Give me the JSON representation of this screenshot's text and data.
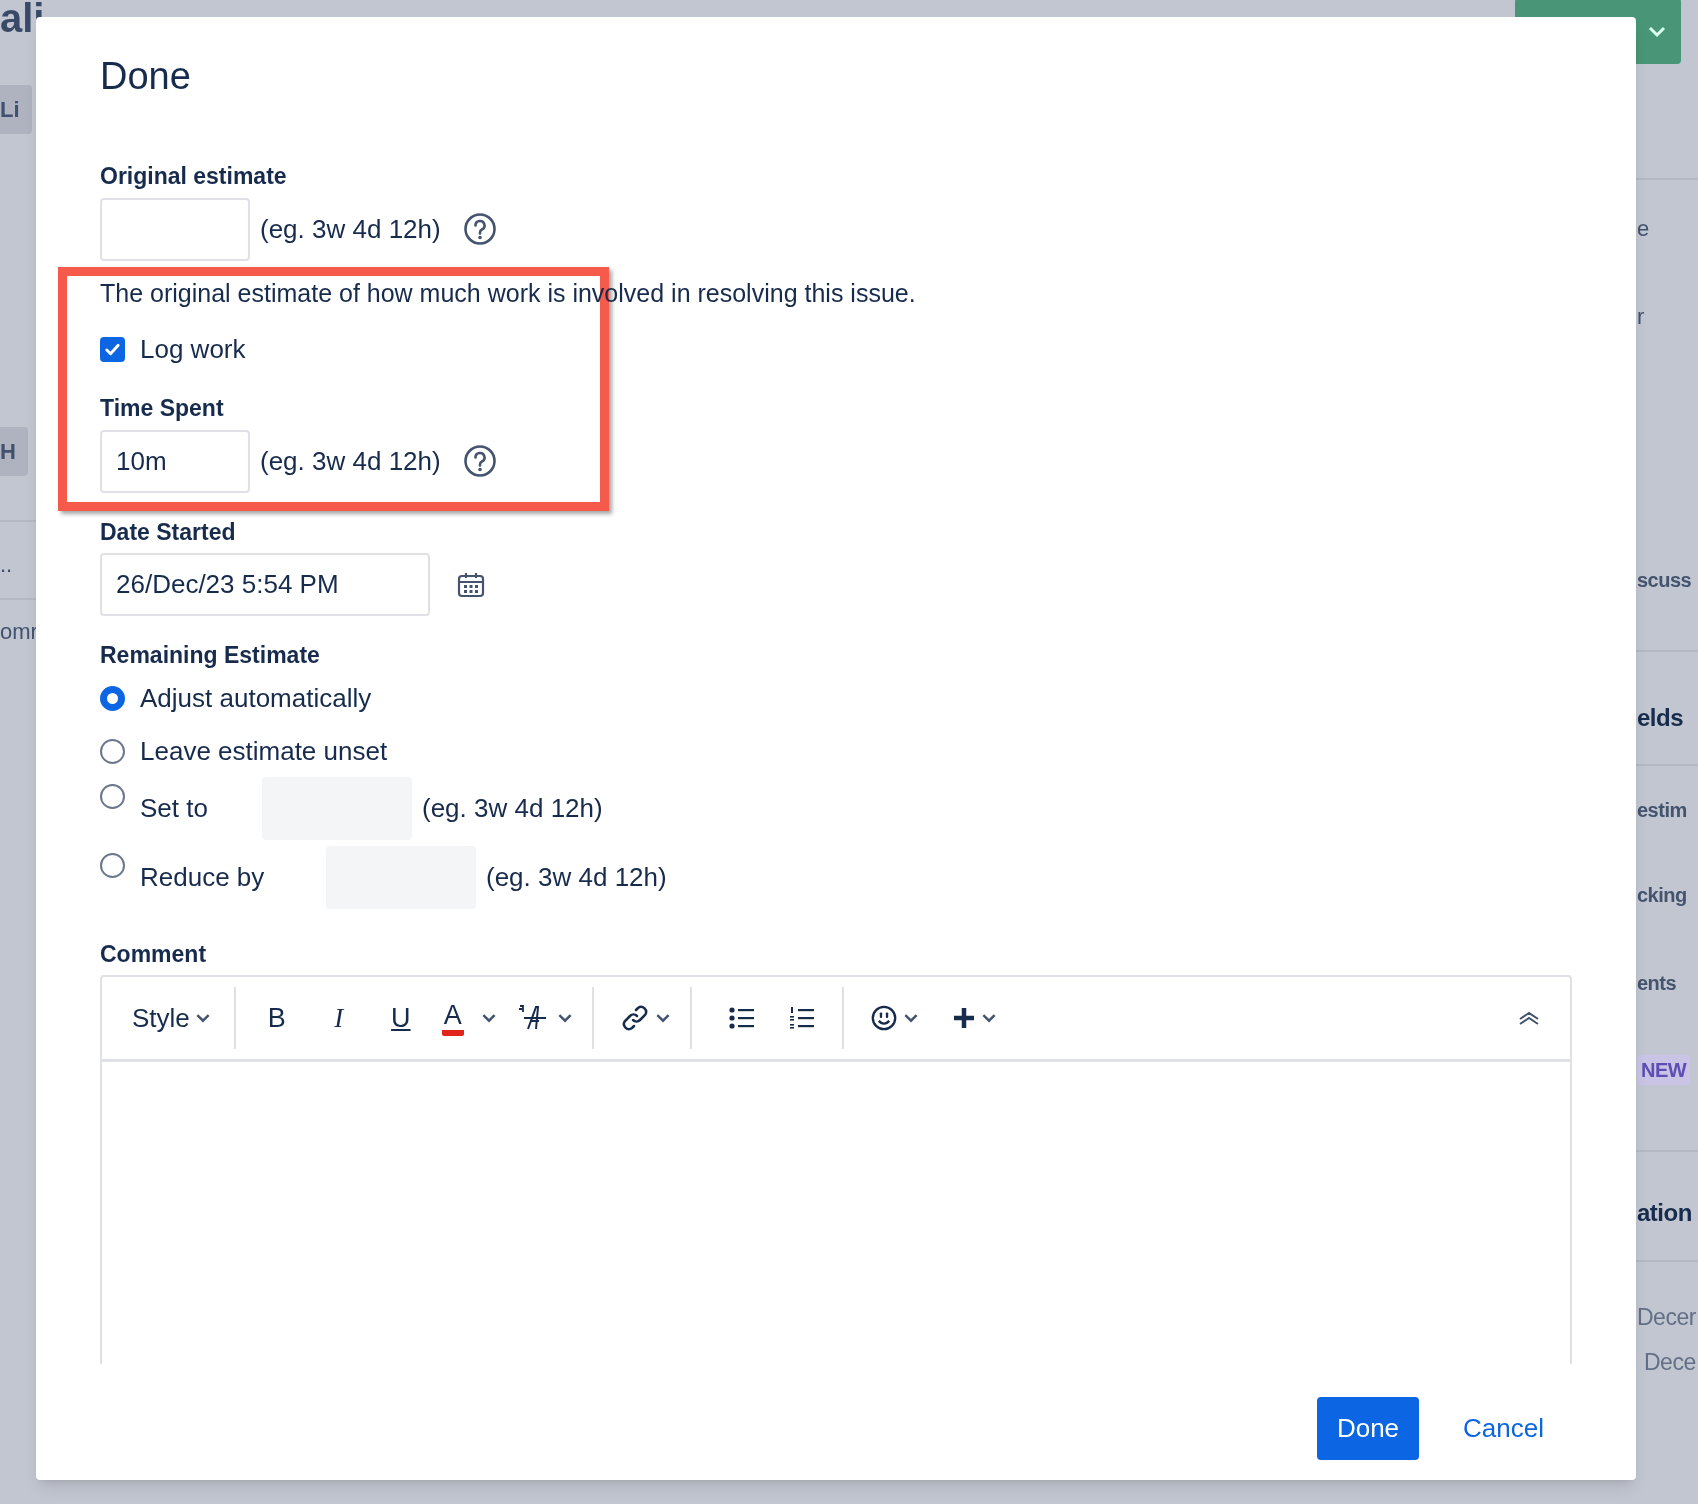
{
  "background": {
    "page_title": "ali",
    "left_items": [
      {
        "text": "Li",
        "kind": "tab"
      },
      {
        "text": "H",
        "kind": "tab"
      },
      {
        "text": "..",
        "kind": "text"
      },
      {
        "text": "omr",
        "kind": "text"
      }
    ],
    "right_items": [
      {
        "text": "e",
        "kind": "text"
      },
      {
        "text": "r",
        "kind": "text"
      },
      {
        "text": "scuss",
        "kind": "heading"
      },
      {
        "text": "elds",
        "kind": "title"
      },
      {
        "text": "estim",
        "kind": "heading"
      },
      {
        "text": "cking",
        "kind": "heading"
      },
      {
        "text": "ents",
        "kind": "heading"
      },
      {
        "text": "NEW",
        "kind": "badge"
      },
      {
        "text": "ation",
        "kind": "title"
      },
      {
        "text": "Decer",
        "kind": "date"
      },
      {
        "text": "Dece",
        "kind": "date"
      }
    ]
  },
  "dialog": {
    "title": "Done",
    "original_estimate": {
      "label": "Original estimate",
      "hint": "(eg. 3w 4d 12h)",
      "description": "The original estimate of how much work is involved in resolving this issue."
    },
    "log_work": {
      "label": "Log work",
      "checked": true
    },
    "time_spent": {
      "label": "Time Spent",
      "value": "10m",
      "hint": "(eg. 3w 4d 12h)"
    },
    "date_started": {
      "label": "Date Started",
      "value": "26/Dec/23 5:54 PM"
    },
    "remaining_estimate": {
      "label": "Remaining Estimate",
      "options": [
        {
          "label": "Adjust automatically",
          "selected": true,
          "kind": "plain"
        },
        {
          "label": "Leave estimate unset",
          "selected": false,
          "kind": "plain"
        },
        {
          "label": "Set to",
          "selected": false,
          "kind": "field",
          "hint": "(eg. 3w 4d 12h)"
        },
        {
          "label": "Reduce by",
          "selected": false,
          "kind": "field",
          "hint": "(eg. 3w 4d 12h)"
        }
      ]
    },
    "comment": {
      "label": "Comment",
      "toolbar": [
        {
          "kind": "style",
          "label": "Style"
        },
        {
          "kind": "divider"
        },
        {
          "kind": "bold",
          "label": "B"
        },
        {
          "kind": "italic",
          "label": "I"
        },
        {
          "kind": "underline",
          "label": "U"
        },
        {
          "kind": "color",
          "label": "A"
        },
        {
          "kind": "more_format"
        },
        {
          "kind": "divider"
        },
        {
          "kind": "link"
        },
        {
          "kind": "divider"
        },
        {
          "kind": "bullets"
        },
        {
          "kind": "numbers"
        },
        {
          "kind": "divider"
        },
        {
          "kind": "emoji"
        },
        {
          "kind": "insert"
        }
      ]
    },
    "buttons": [
      {
        "label": "Done",
        "kind": "primary"
      },
      {
        "label": "Cancel",
        "kind": "link"
      }
    ]
  }
}
